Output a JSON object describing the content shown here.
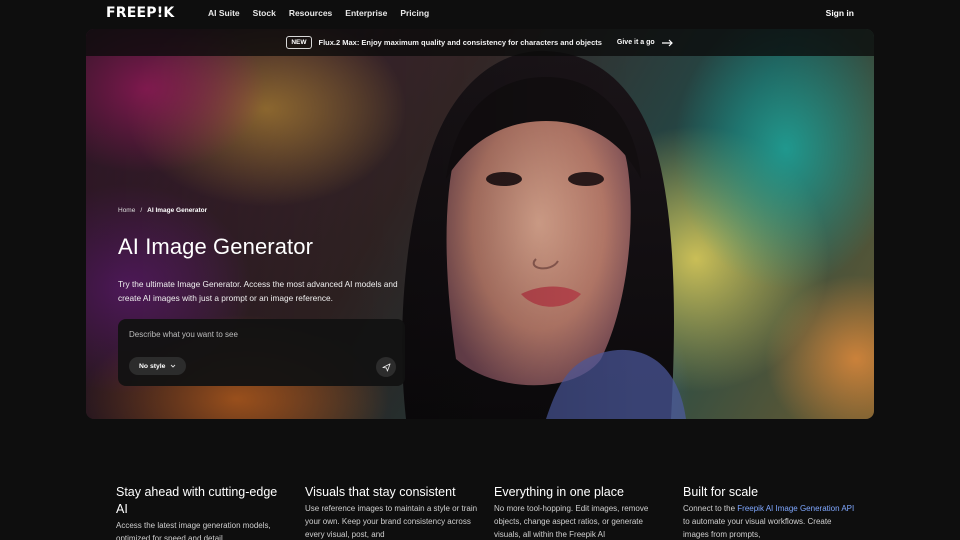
{
  "nav": {
    "logo": "FREEP!K",
    "links": [
      "AI Suite",
      "Stock",
      "Resources",
      "Enterprise",
      "Pricing"
    ],
    "signin": "Sign in"
  },
  "announcement": {
    "badge": "NEW",
    "text": "Flux.2 Max: Enjoy maximum quality and consistency for characters and objects",
    "link": "Give it a go"
  },
  "hero": {
    "breadcrumb": {
      "home": "Home",
      "separator": "/",
      "current": "AI Image Generator"
    },
    "title": "AI Image Generator",
    "description": "Try the ultimate Image Generator. Access the most advanced AI models and create AI images with just a prompt or an image reference.",
    "prompt": {
      "placeholder": "Describe what you want to see",
      "style_label": "No style"
    }
  },
  "features": [
    {
      "title": "Stay ahead with cutting-edge AI",
      "body": "Access the latest image generation models, optimized for speed and detail"
    },
    {
      "title": "Visuals that stay consistent",
      "body": "Use reference images to maintain a style or train your own. Keep your brand consistency across every visual, post, and"
    },
    {
      "title": "Everything in one place",
      "body": "No more tool-hopping. Edit images, remove objects, change aspect ratios, or generate visuals, all within the Freepik AI"
    },
    {
      "title": "Built for scale",
      "body_pre": "Connect to the ",
      "link": "Freepik AI Image Generation API",
      "body_post": " to automate your visual workflows. Create images from prompts,"
    }
  ],
  "colors": {
    "background": "#0e0e0e",
    "link": "#7fa7ff",
    "prompt_bg": "#121212"
  }
}
